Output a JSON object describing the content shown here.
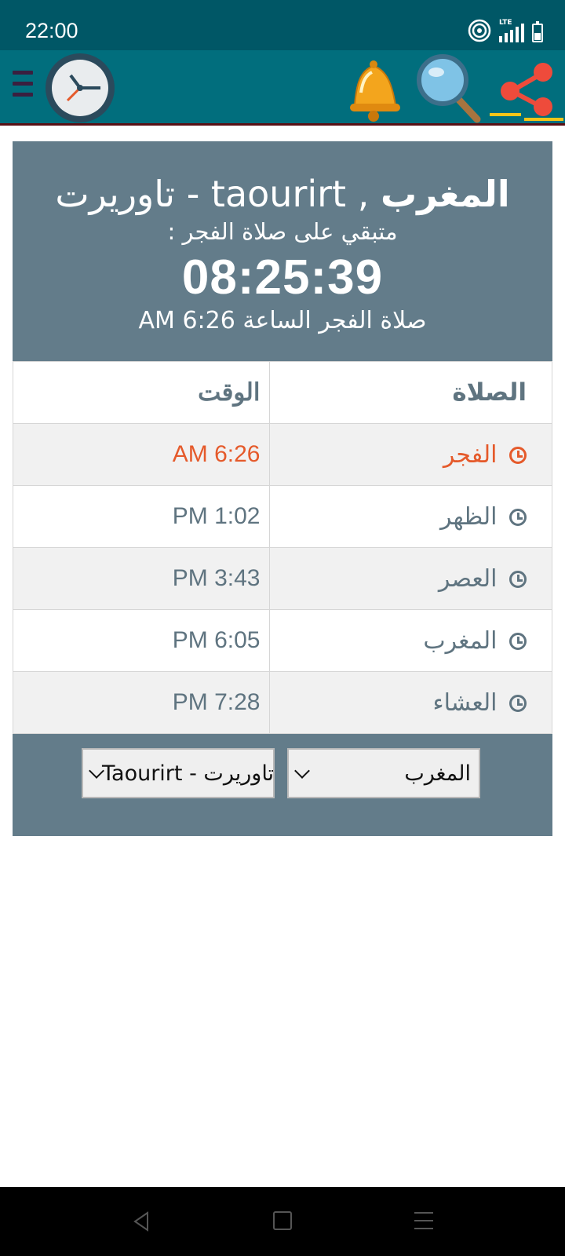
{
  "status": {
    "time": "22:00",
    "network": "LTE"
  },
  "header": {
    "icons": [
      "menu-icon",
      "clock-logo",
      "bell-icon",
      "search-icon",
      "share-icon"
    ]
  },
  "hero": {
    "country": "المغرب",
    "separator": " , ",
    "city": "taourirt - تاوريرت",
    "remaining_label": "متبقي على صلاة الفجر :",
    "countdown": "08:25:39",
    "next_prayer_text": "صلاة الفجر الساعة 6:26 AM"
  },
  "table": {
    "headers": {
      "prayer": "الصلاة",
      "time": "الوقت"
    },
    "rows": [
      {
        "name": "الفجر",
        "time": "AM 6:26",
        "active": true
      },
      {
        "name": "الظهر",
        "time": "PM 1:02"
      },
      {
        "name": "العصر",
        "time": "PM 3:43"
      },
      {
        "name": "المغرب",
        "time": "PM 6:05"
      },
      {
        "name": "العشاء",
        "time": "PM 7:28"
      }
    ]
  },
  "selects": {
    "country": "المغرب",
    "city": "Taourirt - تاوريرت"
  },
  "colors": {
    "status_bar": "#005766",
    "app_bar": "#016e7d",
    "card": "#637c8a",
    "active_prayer": "#e55a2b",
    "text_muted": "#5f7480"
  }
}
